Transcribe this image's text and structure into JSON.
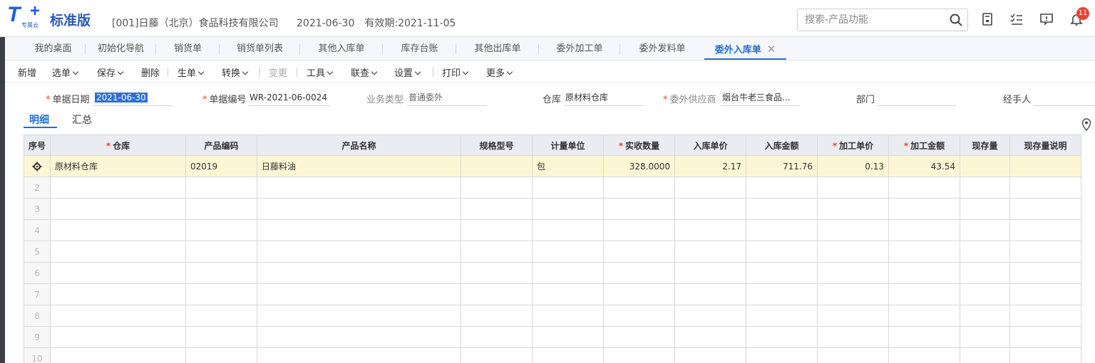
{
  "header": {
    "logo_letter": "T",
    "logo_sub": "专属云",
    "edition": "标准版",
    "company": "[001]日藤（北京）食品科技有限公司",
    "date": "2021-06-30",
    "validity": "有效期:2021-11-05",
    "search_placeholder": "搜索-产品功能",
    "notification_count": "11"
  },
  "tabs": [
    {
      "label": "我的桌面"
    },
    {
      "label": "初始化导航"
    },
    {
      "label": "销货单"
    },
    {
      "label": "销货单列表"
    },
    {
      "label": "其他入库单"
    },
    {
      "label": "库存台账"
    },
    {
      "label": "其他出库单"
    },
    {
      "label": "委外加工单"
    },
    {
      "label": "委外发料单"
    },
    {
      "label": "委外入库单",
      "active": true
    }
  ],
  "toolbar": {
    "new": "新增",
    "select": "选单",
    "save": "保存",
    "delete": "删除",
    "generate": "生单",
    "convert": "转换",
    "change": "变更",
    "tools": "工具",
    "linked": "联查",
    "settings": "设置",
    "print": "打印",
    "more": "更多"
  },
  "form": {
    "date_label": "单据日期",
    "date_value": "2021-06-30",
    "number_label": "单据编号",
    "number_value": "WR-2021-06-0024",
    "business_type_label": "业务类型",
    "business_type_value": "普通委外",
    "warehouse_label": "仓库",
    "warehouse_value": "原材料仓库",
    "supplier_label": "委外供应商",
    "supplier_value": "烟台牛老三食品...",
    "department_label": "部门",
    "department_value": "",
    "handler_label": "经手人",
    "handler_value": ""
  },
  "subtabs": {
    "detail": "明细",
    "summary": "汇总"
  },
  "table": {
    "columns": [
      {
        "label": "序号",
        "required": false
      },
      {
        "label": "仓库",
        "required": true
      },
      {
        "label": "产品编码",
        "required": false
      },
      {
        "label": "产品名称",
        "required": false
      },
      {
        "label": "规格型号",
        "required": false
      },
      {
        "label": "计量单位",
        "required": false
      },
      {
        "label": "实收数量",
        "required": true
      },
      {
        "label": "入库单价",
        "required": false
      },
      {
        "label": "入库金额",
        "required": false
      },
      {
        "label": "加工单价",
        "required": true
      },
      {
        "label": "加工金额",
        "required": true
      },
      {
        "label": "现存量",
        "required": false
      },
      {
        "label": "现存量说明",
        "required": false
      }
    ],
    "rows": [
      {
        "warehouse": "原材料仓库",
        "code": "02019",
        "name": "日藤料油",
        "spec": "",
        "unit": "包",
        "qty": "328.0000",
        "in_price": "2.17",
        "in_amount": "711.76",
        "proc_price": "0.13",
        "proc_amount": "43.54",
        "stock": "",
        "stock_note": ""
      }
    ],
    "empty_row_numbers": [
      "2",
      "3",
      "4",
      "5",
      "6",
      "7",
      "8",
      "9",
      "10"
    ]
  }
}
